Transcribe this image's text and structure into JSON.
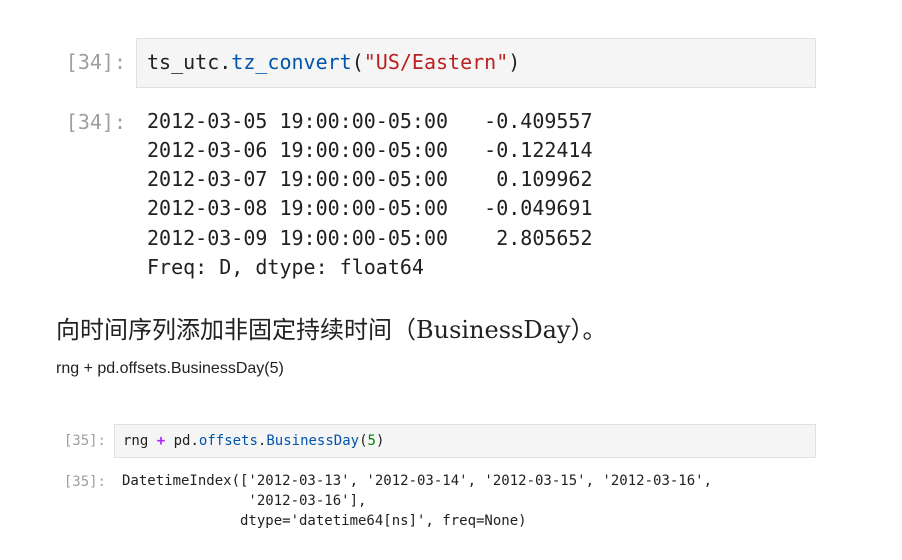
{
  "cell34": {
    "in_prompt": "[34]:",
    "out_prompt": "[34]:",
    "code": {
      "obj": "ts_utc",
      "dot": ".",
      "method": "tz_convert",
      "open": "(",
      "arg": "\"US/Eastern\"",
      "close": ")"
    },
    "output_lines": [
      "2012-03-05 19:00:00-05:00   -0.409557",
      "2012-03-06 19:00:00-05:00   -0.122414",
      "2012-03-07 19:00:00-05:00    0.109962",
      "2012-03-08 19:00:00-05:00   -0.049691",
      "2012-03-09 19:00:00-05:00    2.805652",
      "Freq: D, dtype: float64"
    ]
  },
  "notes": {
    "heading": "向时间序列添加非固定持续时间（BusinessDay）。",
    "code_line": "rng + pd.offsets.BusinessDay(5)"
  },
  "cell35": {
    "in_prompt": "[35]:",
    "out_prompt": "[35]:",
    "code": {
      "rng": "rng",
      "plus": "+",
      "pd": "pd",
      "dot1": ".",
      "offsets": "offsets",
      "dot2": ".",
      "cls": "BusinessDay",
      "open": "(",
      "num": "5",
      "close": ")"
    },
    "output_lines": [
      "DatetimeIndex(['2012-03-13', '2012-03-14', '2012-03-15', '2012-03-16',",
      "               '2012-03-16'],",
      "              dtype='datetime64[ns]', freq=None)"
    ]
  }
}
